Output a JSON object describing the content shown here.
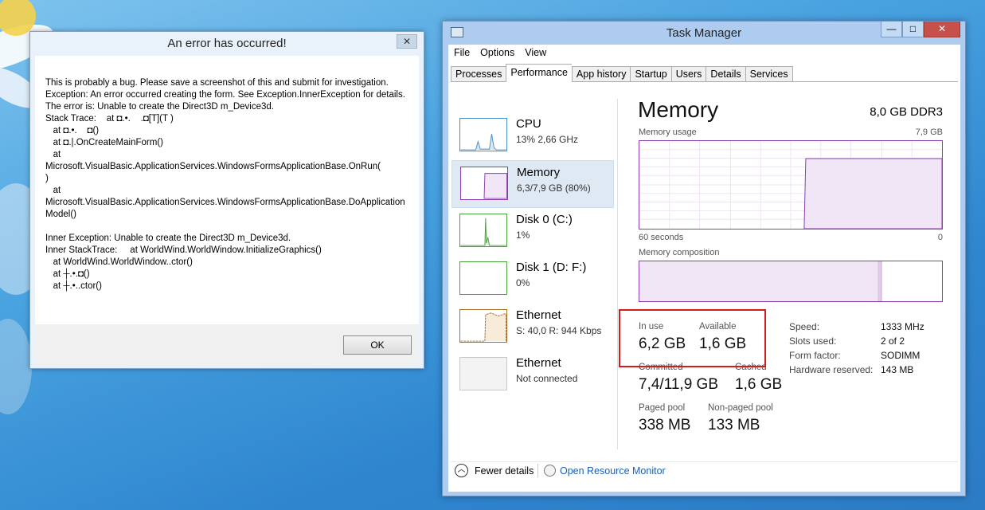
{
  "error_dialog": {
    "title": "An error has occurred!",
    "close_label": "✕",
    "message": "This is probably a bug. Please save a screenshot of this and submit for investigation.\nException: An error occurred creating the form. See Exception.InnerException for details.  The error is: Unable to create the Direct3D m_Device3d.\nStack Trace:    at ◘.•.    .◘[T](T )\n   at ◘.•.    ◘()\n   at ◘.|.OnCreateMainForm()\n   at\nMicrosoft.VisualBasic.ApplicationServices.WindowsFormsApplicationBase.OnRun(\n)\n   at\nMicrosoft.VisualBasic.ApplicationServices.WindowsFormsApplicationBase.DoApplicationModel()\n\nInner Exception: Unable to create the Direct3D m_Device3d.\nInner StackTrace:     at WorldWind.WorldWindow.InitializeGraphics()\n   at WorldWind.WorldWindow..ctor()\n   at ┼.•.◘()\n   at ┼.•..ctor()",
    "ok_label": "OK"
  },
  "task_manager": {
    "title": "Task Manager",
    "controls": {
      "minimize": "—",
      "maximize": "□",
      "close": "✕"
    },
    "menu": [
      "File",
      "Options",
      "View"
    ],
    "tabs": [
      "Processes",
      "Performance",
      "App history",
      "Startup",
      "Users",
      "Details",
      "Services"
    ],
    "active_tab": "Performance",
    "resources": [
      {
        "name": "CPU",
        "sub": "13% 2,66 GHz",
        "selected": false
      },
      {
        "name": "Memory",
        "sub": "6,3/7,9 GB (80%)",
        "selected": true
      },
      {
        "name": "Disk 0 (C:)",
        "sub": "1%",
        "selected": false
      },
      {
        "name": "Disk 1 (D: F:)",
        "sub": "0%",
        "selected": false
      },
      {
        "name": "Ethernet",
        "sub": "S: 40,0  R: 944 Kbps",
        "selected": false
      },
      {
        "name": "Ethernet",
        "sub": "Not connected",
        "selected": false
      }
    ],
    "memory": {
      "title": "Memory",
      "spec": "8,0 GB DDR3",
      "usage_label": "Memory usage",
      "usage_max": "7,9 GB",
      "time_left": "60 seconds",
      "time_right": "0",
      "composition_label": "Memory composition",
      "usage_graph": {
        "before_level": 0,
        "after_level": 0.8,
        "jump_fraction": 0.55
      },
      "composition": {
        "in_use_fraction": 0.79,
        "modified_fraction": 0.01
      },
      "stats": {
        "in_use_label": "In use",
        "in_use": "6,2 GB",
        "available_label": "Available",
        "available": "1,6 GB",
        "committed_label": "Committed",
        "committed": "7,4/11,9 GB",
        "cached_label": "Cached",
        "cached": "1,6 GB",
        "paged_label": "Paged pool",
        "paged": "338 MB",
        "nonpaged_label": "Non-paged pool",
        "nonpaged": "133 MB"
      },
      "specs": [
        {
          "k": "Speed:",
          "v": "1333 MHz"
        },
        {
          "k": "Slots used:",
          "v": "2 of 2"
        },
        {
          "k": "Form factor:",
          "v": "SODIMM"
        },
        {
          "k": "Hardware reserved:",
          "v": "143 MB"
        }
      ]
    },
    "footer": {
      "fewer_details": "Fewer details",
      "open_resource_monitor": "Open Resource Monitor"
    },
    "colors": {
      "memory": "#8b3fae",
      "cpu": "#4a90c6",
      "disk": "#4aa23b",
      "ethernet": "#a7702a"
    }
  }
}
